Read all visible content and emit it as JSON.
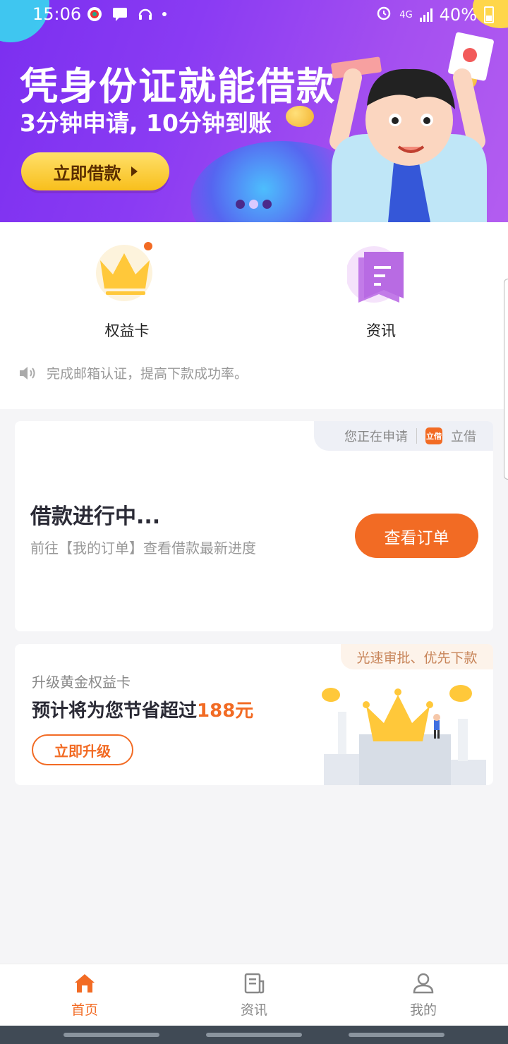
{
  "status_bar": {
    "time": "15:06",
    "network": "4G",
    "battery": "40%"
  },
  "banner": {
    "title": "凭身份证就能借款",
    "subtitle": "3分钟申请, 10分钟到账",
    "button_label": "立即借款",
    "slide_count": 3,
    "active_slide": 1
  },
  "entries": [
    {
      "label": "权益卡",
      "icon": "crown-icon"
    },
    {
      "label": "资讯",
      "icon": "document-icon"
    }
  ],
  "notice": {
    "icon": "speaker-icon",
    "text": "完成邮箱认证，提高下款成功率。"
  },
  "loan_card": {
    "tag_text": "您正在申请",
    "brand_badge": "立借",
    "brand_name": "立借",
    "title": "借款进行中...",
    "subtitle": "前往【我的订单】查看借款最新进度",
    "button_label": "查看订单"
  },
  "upgrade_card": {
    "tag_text": "光速审批、优先下款",
    "title": "升级黄金权益卡",
    "saving_prefix": "预计将为您节省超过",
    "saving_amount": "188元",
    "button_label": "立即升级"
  },
  "bottom_nav": [
    {
      "label": "首页",
      "icon": "home-icon",
      "active": true
    },
    {
      "label": "资讯",
      "icon": "news-icon",
      "active": false
    },
    {
      "label": "我的",
      "icon": "profile-icon",
      "active": false
    }
  ],
  "colors": {
    "accent": "#f26b24",
    "banner": "#8a3bf3",
    "gold": "#f8bf1c"
  }
}
